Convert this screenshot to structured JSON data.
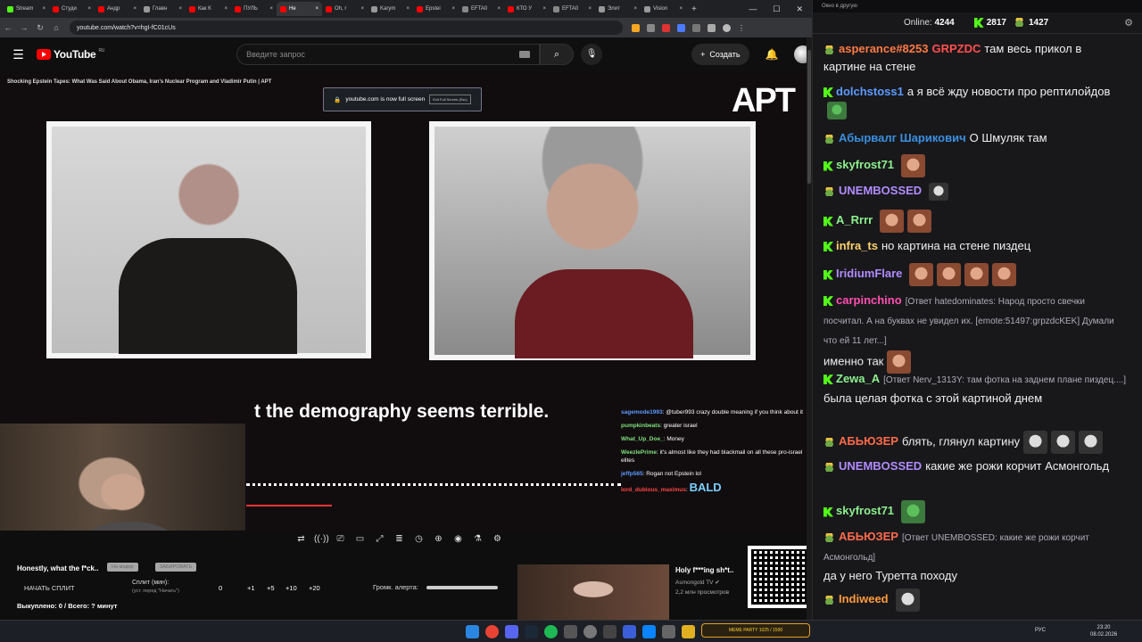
{
  "browser": {
    "tabs": [
      {
        "label": "Stream",
        "color": "#53fc18"
      },
      {
        "label": "Студи",
        "color": "#ff0000"
      },
      {
        "label": "Андр",
        "color": "#ff0000"
      },
      {
        "label": "Главн",
        "color": "#999999"
      },
      {
        "label": "Как К",
        "color": "#ff0000"
      },
      {
        "label": "ПУЛЬ",
        "color": "#ff0000"
      },
      {
        "label": "Не",
        "color": "#ff0000",
        "active": true
      },
      {
        "label": "Oh, r",
        "color": "#ff0000"
      },
      {
        "label": "Karym",
        "color": "#999999"
      },
      {
        "label": "Epstei",
        "color": "#ff0000"
      },
      {
        "label": "EFTA0",
        "color": "#888888"
      },
      {
        "label": "КТО У",
        "color": "#ff0000"
      },
      {
        "label": "EFTA0",
        "color": "#888888"
      },
      {
        "label": "Элит",
        "color": "#999999"
      },
      {
        "label": "Vision",
        "color": "#999999"
      }
    ],
    "url": "youtube.com/watch?v=hgI-fC01cUs"
  },
  "youtube": {
    "logo": "YouTube",
    "region": "RU",
    "search_placeholder": "Введите запрос",
    "create_label": "Создать"
  },
  "video": {
    "title": "Shocking Epstein Tapes: What Was Said About Obama, Iran's Nuclear Program and Vladimir Putin | APT",
    "fullscreen_note": "youtube.com is now full screen",
    "exit_label": "Exit Full Screen (Esc)",
    "brand": "APT",
    "caption": "t the demography seems terrible.",
    "chat": [
      {
        "user": "sagemode1993",
        "color": "#5b9bff",
        "text": "@tuber993 crazy double meaning if you think about it"
      },
      {
        "user": "pumpkinbeats",
        "color": "#7ee07e",
        "text": "greater israel"
      },
      {
        "user": "What_Up_Doe_",
        "color": "#7ee07e",
        "text": "Money"
      },
      {
        "user": "WeezlePrime",
        "color": "#7ee07e",
        "text": "it's almost like they had blackmail on all these pro-israel elites"
      },
      {
        "user": "jeffp565",
        "color": "#5b9bff",
        "text": "Rogan not Epstein lol"
      },
      {
        "user": "lord_dubious_maximus",
        "color": "#ff4444",
        "text": "BALD"
      }
    ]
  },
  "controls": {
    "toolbar_icons": [
      "loop-icon",
      "broadcast-icon",
      "cast-icon",
      "folder-icon",
      "resize-icon",
      "list-icon",
      "speed-icon",
      "add-icon",
      "camera-icon",
      "flask-icon",
      "gear-icon"
    ],
    "poll_title": "Honestly, what the f*ck..",
    "chip1": "На модер",
    "chip2": "ЗАБИРОВАТЬ",
    "start_split": "НАЧАТЬ СПЛИТ",
    "split_label": "Сплит (мин):",
    "split_sub": "(уст. перед \"Начать\")",
    "split_value": "0",
    "increments": [
      "+1",
      "+5",
      "+10",
      "+20"
    ],
    "alert_label": "Громк. алерта:",
    "stats": "Выкуплено: 0 / Всего: ? минут",
    "rec_title": "Holy f***ing sh*t..",
    "rec_channel": "Asmongold TV",
    "rec_views": "2,2 млн просмотров"
  },
  "chat_panel": {
    "popout_title": "Окно в другую",
    "online_label": "Online:",
    "online": "4244",
    "count1": "2817",
    "count2": "1427",
    "messages": [
      {
        "user": "asperance#8253",
        "badge": "pepe",
        "color": "#ff7a45",
        "tag": "GRPZDC",
        "text": "там весь прикол в картине на стене"
      },
      {
        "user": "dolchstoss1",
        "badge": "kick",
        "color": "#5b9bff",
        "text": "а я всё жду новости про рептилойдов"
      },
      {
        "user": "Абырвалг Шарикович",
        "badge": "pepe",
        "color": "#3a8fe0",
        "text": "О Шмуляк там"
      },
      {
        "user": "skyfrost71",
        "badge": "kick",
        "color": "#8df08d",
        "text": ""
      },
      {
        "user": "UNEMBOSSED",
        "badge": "pepe",
        "color": "#b18cff",
        "text": ""
      },
      {
        "user": "A_Rrrr",
        "badge": "kick",
        "color": "#8df08d",
        "text": ""
      },
      {
        "user": "infra_ts",
        "badge": "kick",
        "color": "#ffd36e",
        "text": "но картина на стене пиздец"
      },
      {
        "user": "IridiumFlare",
        "badge": "kick",
        "color": "#b18cff",
        "text": ""
      },
      {
        "user": "carpinchino",
        "badge": "kick",
        "color": "#ff4fb0",
        "reply": "[Ответ hatedominates: Народ просто свечки посчитал. А на буквах не увидел их. [emote:51497:grpzdcKEK] Думали что ей 11 лет...]",
        "text": "именно так"
      },
      {
        "user": "Zewa_A",
        "badge": "kick",
        "color": "#8df08d",
        "reply": "[Ответ Nerv_1313Y: там фотка на заднем плане пиздец....]",
        "text": "была целая фотка с этой картиной днем"
      },
      {
        "user": "АБЬЮЗЕР",
        "badge": "pepe",
        "color": "#ff6a4a",
        "text": "блять, глянул картину"
      },
      {
        "user": "UNEMBOSSED",
        "badge": "pepe",
        "color": "#b18cff",
        "text": "какие же рожи корчит Асмонгольд"
      },
      {
        "user": "skyfrost71",
        "badge": "kick",
        "color": "#8df08d",
        "text": ""
      },
      {
        "user": "АБЬЮЗЕР",
        "badge": "pepe",
        "color": "#ff6a4a",
        "reply": "[Ответ UNEMBOSSED: какие же рожи корчит Асмонгольд]",
        "text": "да у него Туретта походу"
      },
      {
        "user": "Indiweed",
        "badge": "pepe",
        "color": "#ff9a3c",
        "text": ""
      }
    ]
  },
  "taskbar": {
    "meme_label": "MEME PARTY",
    "meme_progress": "1025 / 1500",
    "lang": "РУС",
    "time": "23:20",
    "date": "08.02.2026"
  }
}
